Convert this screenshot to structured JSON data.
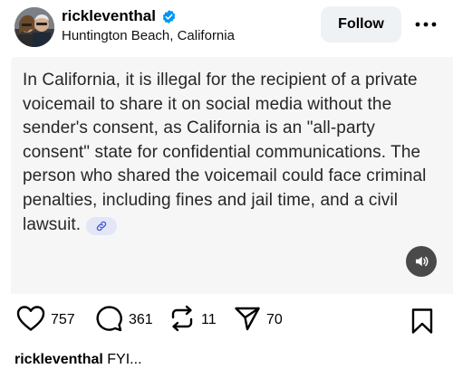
{
  "header": {
    "username": "rickleventhal",
    "location": "Huntington Beach, California",
    "follow_label": "Follow",
    "verified": true
  },
  "post": {
    "text": "In California, it is illegal for the recipient of a private voicemail to share it on social media without the sender's consent, as California is an \"all-party consent\" state for confidential communications. The person who shared the voicemail could face criminal penalties, including fines and jail time, and a civil lawsuit.",
    "icons": {
      "link": "link-icon",
      "audio": "speaker-icon"
    }
  },
  "actions": {
    "likes": "757",
    "comments": "361",
    "reposts": "11",
    "shares": "70"
  },
  "caption": {
    "username": "rickleventhal",
    "text": "FYI..."
  },
  "colors": {
    "verified_blue": "#0095f6",
    "follow_bg": "#eff2f5",
    "media_bg": "#f6f6f6",
    "link_chip_bg": "#e3e6f6",
    "audio_button_bg": "#4a4a4a"
  }
}
